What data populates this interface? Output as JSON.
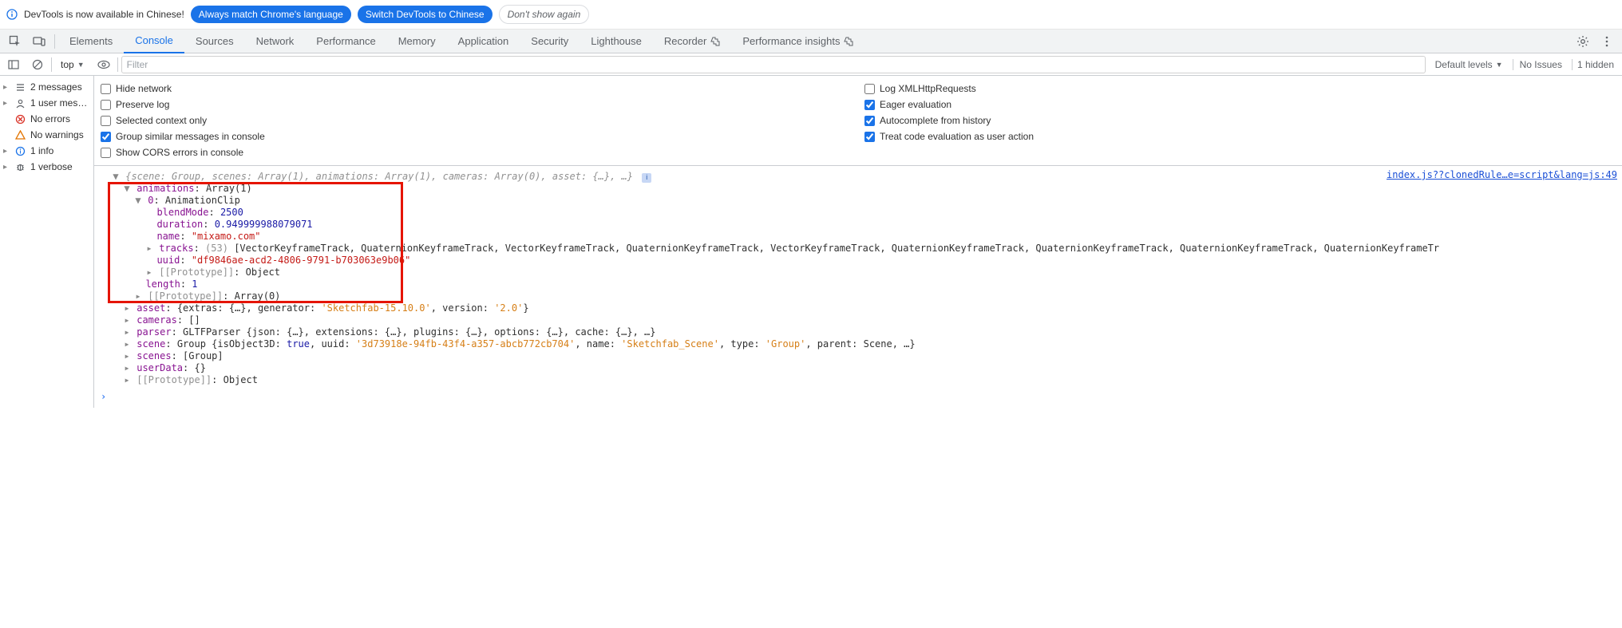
{
  "banner": {
    "text": "DevTools is now available in Chinese!",
    "btn1": "Always match Chrome's language",
    "btn2": "Switch DevTools to Chinese",
    "btn3": "Don't show again"
  },
  "tabs": [
    "Elements",
    "Console",
    "Sources",
    "Network",
    "Performance",
    "Memory",
    "Application",
    "Security",
    "Lighthouse",
    "Recorder",
    "Performance insights"
  ],
  "activeTab": "Console",
  "toolbar": {
    "context": "top",
    "filterPlaceholder": "Filter",
    "levels": "Default levels",
    "issues": "No Issues",
    "hidden": "1 hidden"
  },
  "sidebar": [
    {
      "arrow": "▸",
      "icon": "list",
      "label": "2 messages"
    },
    {
      "arrow": "▸",
      "icon": "user",
      "label": "1 user mes…"
    },
    {
      "arrow": "",
      "icon": "x-red",
      "label": "No errors"
    },
    {
      "arrow": "",
      "icon": "warn",
      "label": "No warnings"
    },
    {
      "arrow": "▸",
      "icon": "info",
      "label": "1 info"
    },
    {
      "arrow": "▸",
      "icon": "bug",
      "label": "1 verbose"
    }
  ],
  "settings": {
    "left": [
      {
        "checked": false,
        "label": "Hide network"
      },
      {
        "checked": false,
        "label": "Preserve log"
      },
      {
        "checked": false,
        "label": "Selected context only"
      },
      {
        "checked": true,
        "label": "Group similar messages in console"
      },
      {
        "checked": false,
        "label": "Show CORS errors in console"
      }
    ],
    "right": [
      {
        "checked": false,
        "label": "Log XMLHttpRequests"
      },
      {
        "checked": true,
        "label": "Eager evaluation"
      },
      {
        "checked": true,
        "label": "Autocomplete from history"
      },
      {
        "checked": true,
        "label": "Treat code evaluation as user action"
      }
    ]
  },
  "sourceLink": "index.js??clonedRule…e=script&lang=js:49",
  "obj": {
    "summary": "{scene: Group, scenes: Array(1), animations: Array(1), cameras: Array(0), asset: {…}, …}",
    "animations": {
      "header": "Array(1)",
      "clip": {
        "type": "AnimationClip",
        "blendMode": "2500",
        "duration": "0.949999988079071",
        "name": "\"mixamo.com\"",
        "tracksCount": "(53)",
        "tracksPreview": "[VectorKeyframeTrack, QuaternionKeyframeTrack, VectorKeyframeTrack, QuaternionKeyframeTrack, VectorKeyframeTrack, QuaternionKeyframeTrack, QuaternionKeyframeTrack, QuaternionKeyframeTrack, QuaternionKeyframeTr",
        "uuid": "\"df9846ae-acd2-4806-9791-b703063e9b06\"",
        "proto0": "Object",
        "length": "1",
        "proto1": "Array(0)"
      }
    },
    "asset": "{extras: {…}, generator: 'Sketchfab-15.10.0', version: '2.0'}",
    "cameras": "[]",
    "parser": "GLTFParser {json: {…}, extensions: {…}, plugins: {…}, options: {…}, cache: {…}, …}",
    "scene": {
      "uuid": "'3d73918e-94fb-43f4-a357-abcb772cb704'",
      "name": "'Sketchfab_Scene'",
      "type": "'Group'"
    },
    "scenes": "[Group]",
    "userData": "{}",
    "proto": "Object"
  }
}
